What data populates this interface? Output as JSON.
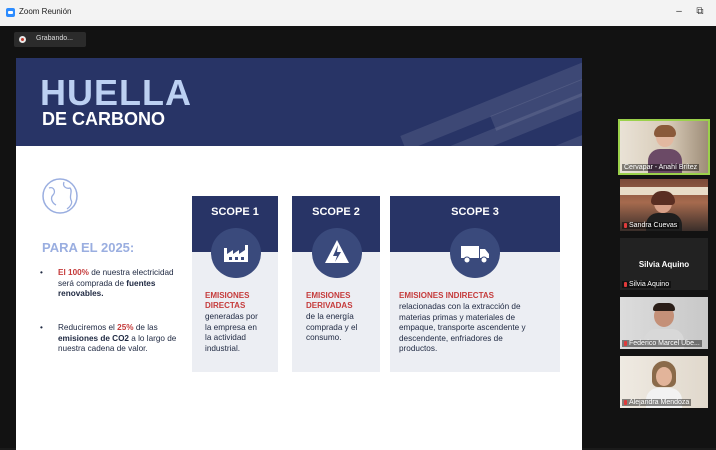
{
  "window": {
    "title": "Zoom Reunión",
    "minimize": "–",
    "restore": "⧉"
  },
  "recording": {
    "label": "Grabando..."
  },
  "slide": {
    "title_main": "HUELLA",
    "title_sub": "DE CARBONO",
    "goal_heading": "PARA EL 2025:",
    "bullets": [
      {
        "dot": "•",
        "parts": [
          {
            "t": "El 100%",
            "s": "red"
          },
          {
            "t": " de nuestra electricidad será comprada de ",
            "s": ""
          },
          {
            "t": "fuentes renovables.",
            "s": "bold"
          }
        ]
      },
      {
        "dot": "•",
        "parts": [
          {
            "t": "Reduciremos el ",
            "s": ""
          },
          {
            "t": "25%",
            "s": "red"
          },
          {
            "t": " de las ",
            "s": ""
          },
          {
            "t": "emisiones de CO2",
            "s": "bold"
          },
          {
            "t": " a lo largo de nuestra cadena de valor.",
            "s": ""
          }
        ]
      }
    ],
    "scopes": [
      {
        "title": "SCOPE 1",
        "icon": "factory-icon",
        "heading_lines": [
          "EMISIONES",
          "DIRECTAS"
        ],
        "text_lines": [
          "generadas por",
          "la empresa en",
          "la actividad",
          "industrial."
        ]
      },
      {
        "title": "SCOPE 2",
        "icon": "lightning-icon",
        "heading_lines": [
          "EMISIONES",
          "DERIVADAS"
        ],
        "text_lines": [
          "de la energía",
          "comprada y el",
          "consumo."
        ]
      },
      {
        "title": "SCOPE 3",
        "icon": "truck-icon",
        "heading_lines": [
          "EMISIONES INDIRECTAS"
        ],
        "text_lines": [
          "relacionadas con la extracción de",
          "materias primas y materiales de",
          "empaque, transporte ascendente y",
          "descendente, enfriadores de",
          "productos."
        ]
      }
    ]
  },
  "participants": [
    {
      "name": "Cervapar - Anahí Brítez",
      "video": true,
      "active": true,
      "muted": false
    },
    {
      "name": "Sandra Cuevas",
      "video": true,
      "active": false,
      "muted": true
    },
    {
      "name": "Silvia Aquino",
      "video": false,
      "active": false,
      "muted": true
    },
    {
      "name": "Federico Marcel Ube...",
      "video": true,
      "active": false,
      "muted": true
    },
    {
      "name": "Alejandra Mendoza",
      "video": true,
      "active": false,
      "muted": true
    }
  ],
  "colors": {
    "navy": "#283466",
    "accent_red": "#c53b3b",
    "light_blue": "#bcd0f2",
    "active_speaker": "#9bd14b"
  }
}
